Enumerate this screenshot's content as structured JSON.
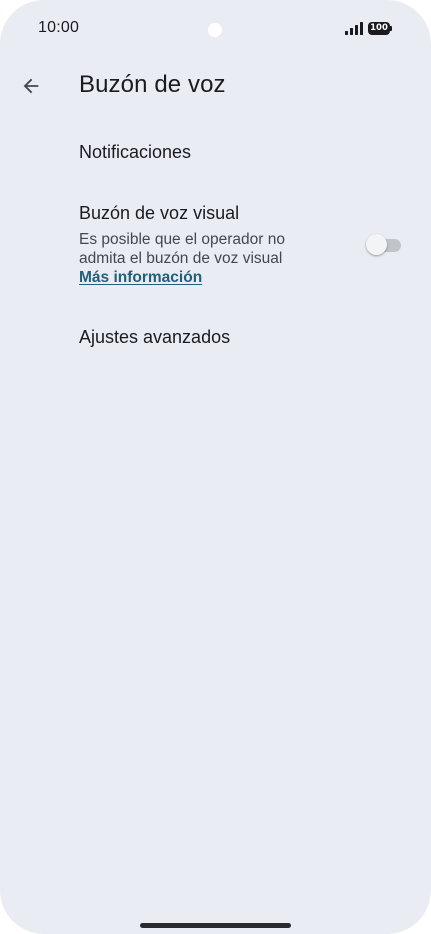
{
  "status_bar": {
    "time": "10:00",
    "battery_level": "100",
    "signal_icon": "signal-bars-icon",
    "battery_icon": "battery-icon"
  },
  "app_bar": {
    "back_icon": "arrow-back-icon",
    "title": "Buzón de voz"
  },
  "settings": {
    "notifications": {
      "title": "Notificaciones"
    },
    "visual_voicemail": {
      "title": "Buzón de voz visual",
      "summary": "Es posible que el operador no admita el buzón de voz visual",
      "link": "Más información",
      "enabled": false
    },
    "advanced": {
      "title": "Ajustes avanzados"
    }
  },
  "colors": {
    "background": "#e9ecf3",
    "text_primary": "#1b1b1f",
    "text_secondary": "#45464f",
    "link": "#21607a",
    "toggle_track_off": "#c2c4cc"
  }
}
